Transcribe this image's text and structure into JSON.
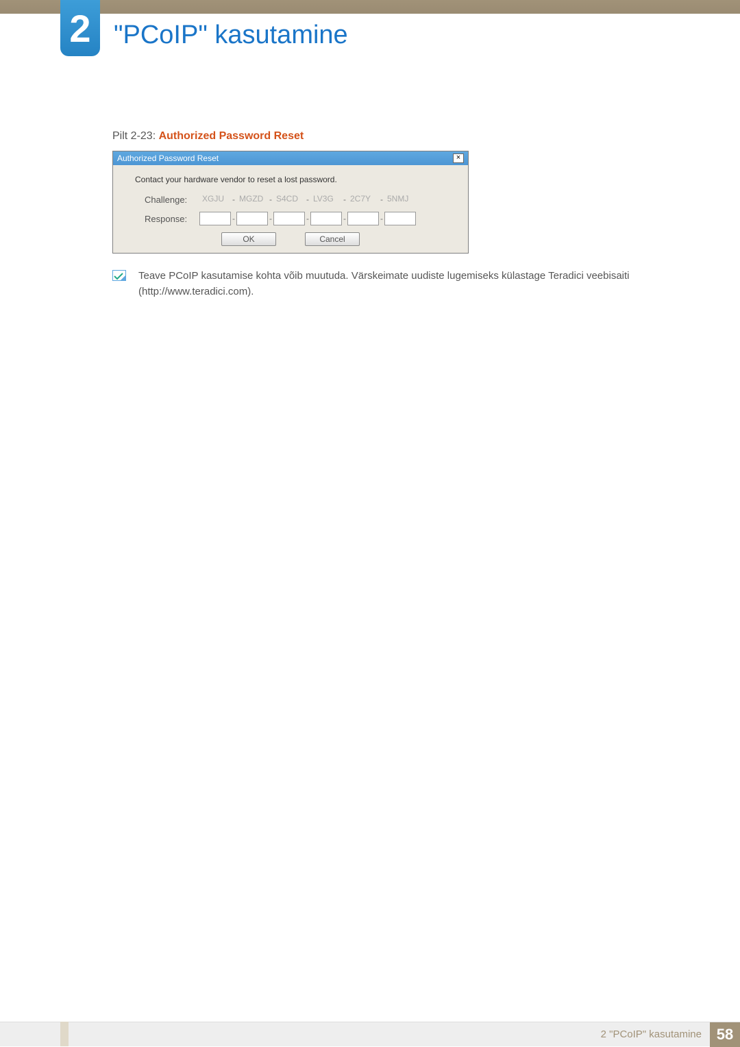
{
  "chapter": {
    "num": "2",
    "title": "\"PCoIP\" kasutamine"
  },
  "caption": {
    "prefix": "Pilt 2-23: ",
    "title": "Authorized Password Reset"
  },
  "dialog": {
    "title": "Authorized Password Reset",
    "close": "×",
    "message": "Contact your hardware vendor to reset a lost password.",
    "challenge_label": "Challenge:",
    "response_label": "Response:",
    "challenge": [
      "XGJU",
      "MGZD",
      "S4CD",
      "LV3G",
      "2C7Y",
      "5NMJ"
    ],
    "ok": "OK",
    "cancel": "Cancel"
  },
  "note": "Teave PCoIP kasutamise kohta võib muutuda. Värskeimate uudiste lugemiseks külastage Teradici veebisaiti (http://www.teradici.com).",
  "footer": {
    "label": "2 \"PCoIP\" kasutamine",
    "page": "58"
  }
}
